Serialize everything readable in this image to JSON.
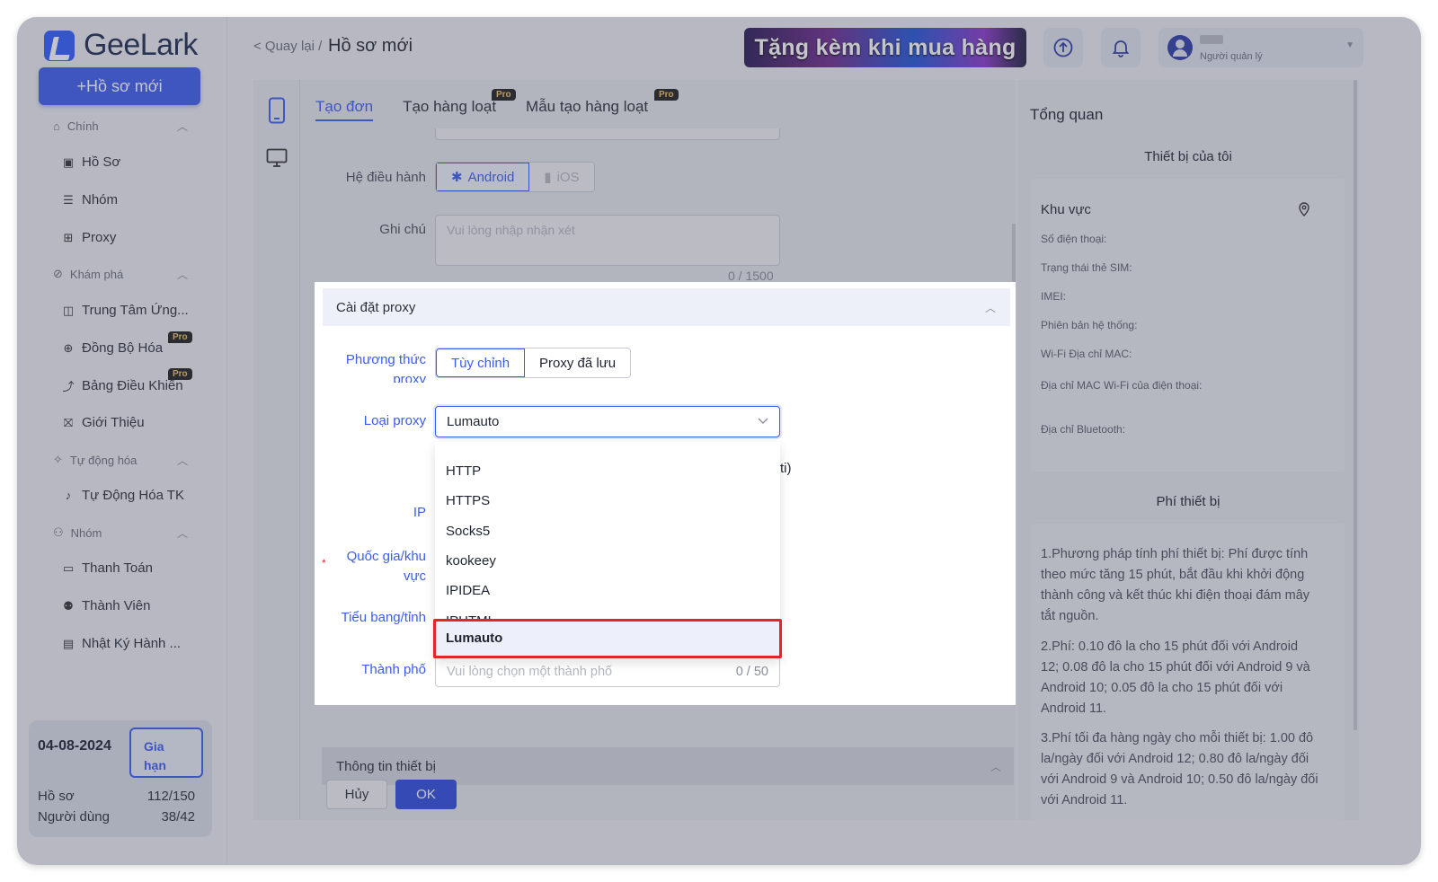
{
  "app": {
    "logo_text": "GeeLark",
    "new_profile_button": "+Hồ sơ mới"
  },
  "sidebar": {
    "sections": [
      {
        "label": "Chính",
        "items": [
          "Hồ Sơ",
          "Nhóm",
          "Proxy"
        ]
      },
      {
        "label": "Khám phá",
        "items": [
          "Trung Tâm Ứng...",
          "Đồng Bộ Hóa",
          "Bảng Điều Khiển",
          "Giới Thiệu"
        ]
      },
      {
        "label": "Tự động hóa",
        "items": [
          "Tự Động Hóa TK"
        ]
      },
      {
        "label": "Nhóm",
        "items": [
          "Thanh Toán",
          "Thành Viên",
          "Nhật Ký Hành ..."
        ]
      }
    ],
    "pro_badge": "Pro",
    "usage": {
      "date": "04-08-2024",
      "renew_label": "Gia hạn",
      "profiles_label": "Hồ sơ",
      "profiles_value": "112/150",
      "users_label": "Người dùng",
      "users_value": "38/42"
    }
  },
  "header": {
    "back_label": "< Quay lại /",
    "title": "Hồ sơ mới",
    "promo_text": "Tặng kèm khi mua hàng",
    "user_role": "Người quản lý"
  },
  "form": {
    "tabs": [
      "Tạo đơn",
      "Tạo hàng loạt",
      "Mẫu tạo hàng loạt"
    ],
    "os_label": "Hệ điều hành",
    "os_options": [
      "Android",
      "iOS"
    ],
    "note_label": "Ghi chú",
    "note_placeholder": "Vui lòng nhập nhận xét",
    "note_counter": "0 / 1500",
    "proxy_section_title": "Cài đặt proxy",
    "proxy_method_label": "Phương thức proxy",
    "proxy_methods": [
      "Tùy chỉnh",
      "Proxy đã lưu"
    ],
    "proxy_type_label": "Loại proxy",
    "proxy_type_value": "Lumauto",
    "proxy_type_options": [
      "HTTP",
      "HTTPS",
      "Socks5",
      "kookeey",
      "IPIDEA",
      "IPHTML",
      "Lumauto"
    ],
    "ip_label": "IP",
    "partial_text": "ti)",
    "country_label": "Quốc gia/khu vực",
    "required_mark": "*",
    "state_label": "Tiểu bang/tỉnh",
    "city_label": "Thành phố",
    "city_placeholder": "Vui lòng chọn một thành phố",
    "city_counter": "0 / 50",
    "device_section_title": "Thông tin thiết bị",
    "cancel_button": "Hủy",
    "ok_button": "OK"
  },
  "overview": {
    "title": "Tổng quan",
    "my_device_title": "Thiết bị của tôi",
    "region_label": "Khu vực",
    "fields": [
      "Số điện thoại:",
      "Trạng thái thẻ SIM:",
      "IMEI:",
      "Phiên bản hệ thống:",
      "Wi-Fi Địa chỉ MAC:",
      "Địa chỉ MAC Wi-Fi của điện thoại:",
      "Địa chỉ Bluetooth:"
    ],
    "fee_title": "Phí thiết bị",
    "fees": [
      "1.Phương pháp tính phí thiết bị: Phí được tính theo mức tăng 15 phút, bắt đầu khi khởi động thành công và kết thúc khi điện thoại đám mây tắt nguồn.",
      "2.Phí: 0.10 đô la cho 15 phút đối với Android 12; 0.08 đô la cho 15 phút đối với Android 9 và Android 10; 0.05 đô la cho 15 phút đối với Android 11.",
      "3.Phí tối đa hàng ngày cho mỗi thiết bị: 1.00 đô la/ngày đối với Android 12; 0.80 đô la/ngày đối với Android 9 và Android 10; 0.50 đô la/ngày đối với Android 11."
    ]
  },
  "colors": {
    "accent": "#3b5cf0",
    "highlight_border": "#e0262b",
    "pro_badge_bg": "#1e1e1e",
    "pro_badge_text": "#f2c25a"
  },
  "icons": [
    "home-icon",
    "profile-icon",
    "list-icon",
    "proxy-icon",
    "compass-icon",
    "app-center-icon",
    "sync-icon",
    "chart-icon",
    "gift-icon",
    "automation-icon",
    "tiktok-icon",
    "group-icon",
    "card-icon",
    "member-icon",
    "log-icon",
    "upload-icon",
    "bell-icon",
    "phone-icon",
    "desktop-icon",
    "android-icon",
    "apple-icon",
    "location-icon"
  ]
}
